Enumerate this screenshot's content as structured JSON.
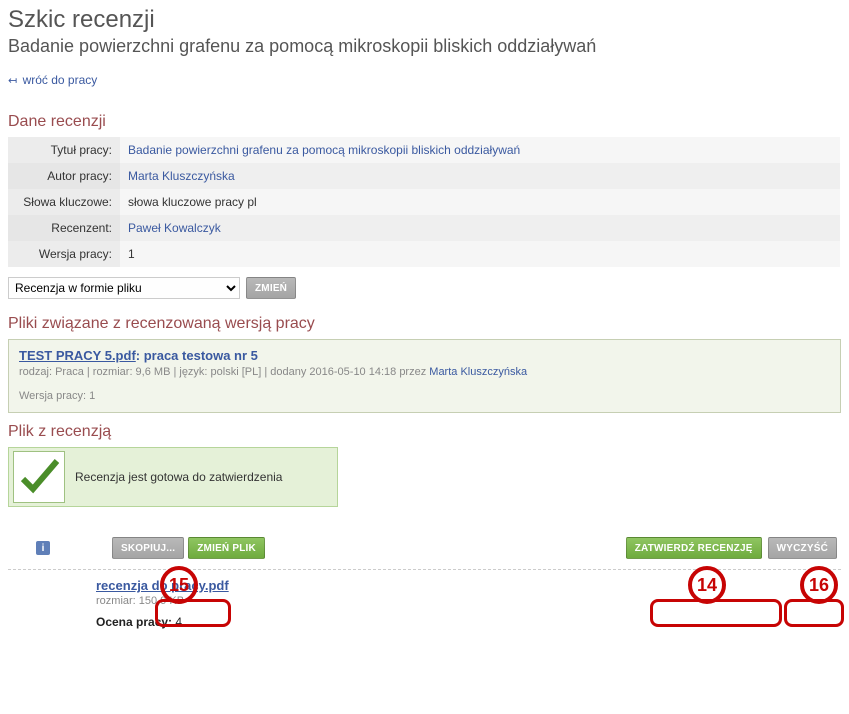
{
  "header": {
    "title": "Szkic recenzji",
    "subtitle": "Badanie powierzchni grafenu za pomocą mikroskopii bliskich oddziaływań",
    "back_link": "wróć do pracy"
  },
  "sections": {
    "details_heading": "Dane recenzji",
    "files_heading": "Pliki związane z recenzowaną wersją pracy",
    "review_file_heading": "Plik z recenzją"
  },
  "details": {
    "tytul_label": "Tytuł pracy:",
    "tytul_value": "Badanie powierzchni grafenu za pomocą mikroskopii bliskich oddziaływań",
    "autor_label": "Autor pracy:",
    "autor_value": "Marta Kluszczyńska",
    "slowa_label": "Słowa kluczowe:",
    "slowa_value": "słowa kluczowe pracy pl",
    "recenzent_label": "Recenzent:",
    "recenzent_value": "Paweł Kowalczyk",
    "wersja_label": "Wersja pracy:",
    "wersja_value": "1"
  },
  "dropdown": {
    "selected": "Recenzja w formie pliku",
    "button": "ZMIEŃ"
  },
  "work_file": {
    "name": "TEST PRACY 5.pdf",
    "desc": ": praca testowa nr 5",
    "meta_pre": "rodzaj: Praca | rozmiar: 9,6 MB | język: polski [PL] | dodany 2016-05-10 14:18 przez ",
    "meta_author": "Marta Kluszczyńska",
    "version": "Wersja pracy: 1"
  },
  "ready": {
    "text": "Recenzja jest gotowa do zatwierdzenia"
  },
  "actions": {
    "skopiuj": "SKOPIUJ...",
    "zmien_plik": "ZMIEŃ PLIK",
    "zatwierdz": "ZATWIERDŹ RECENZJĘ",
    "wyczysc": "WYCZYŚĆ"
  },
  "review_file": {
    "name": "recenzja do pracy.pdf",
    "meta": "rozmiar: 150,9 KB",
    "score_label": "Ocena pracy: ",
    "score_value": "4"
  },
  "callouts": {
    "n14": "14",
    "n15": "15",
    "n16": "16"
  }
}
